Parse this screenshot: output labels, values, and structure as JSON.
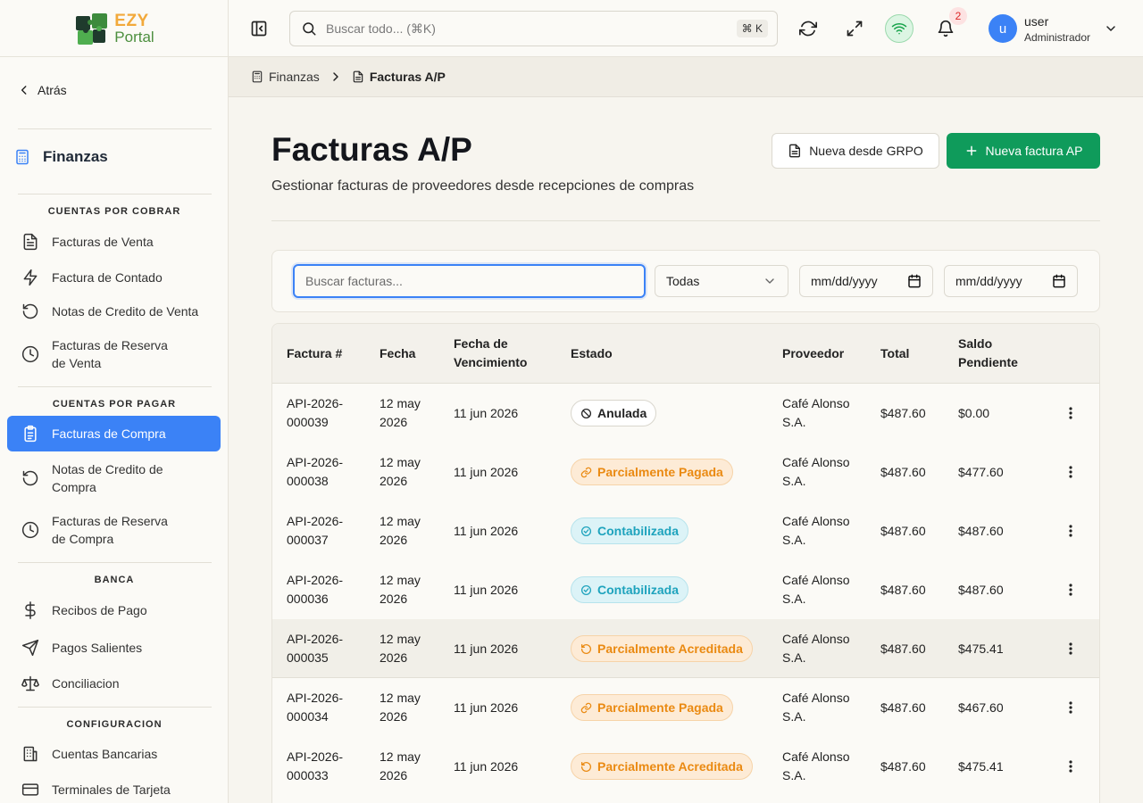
{
  "brand": {
    "logo_top": "EZY",
    "logo_bottom": "Portal"
  },
  "sidebar": {
    "back_label": "Atrás",
    "section_title": "Finanzas",
    "groups": [
      {
        "title": "CUENTAS POR COBRAR",
        "items": [
          {
            "label": "Facturas de Venta",
            "icon": "document-icon"
          },
          {
            "label": "Factura de Contado",
            "icon": "bolt-icon"
          },
          {
            "label": "Notas de Credito de Venta",
            "icon": "rotate-ccw-icon"
          },
          {
            "label": "Facturas de Reserva de Venta",
            "icon": "clock-icon"
          }
        ]
      },
      {
        "title": "CUENTAS POR PAGAR",
        "items": [
          {
            "label": "Facturas de Compra",
            "icon": "clipboard-list-icon",
            "active": true
          },
          {
            "label": "Notas de Credito de Compra",
            "icon": "rotate-ccw-icon"
          },
          {
            "label": "Facturas de Reserva de Compra",
            "icon": "clock-icon"
          }
        ]
      },
      {
        "title": "BANCA",
        "items": [
          {
            "label": "Recibos de Pago",
            "icon": "dollar-icon"
          },
          {
            "label": "Pagos Salientes",
            "icon": "send-icon"
          },
          {
            "label": "Conciliacion",
            "icon": "scale-icon"
          }
        ]
      },
      {
        "title": "CONFIGURACION",
        "items": [
          {
            "label": "Cuentas Bancarias",
            "icon": "bank-icon"
          },
          {
            "label": "Terminales de Tarjeta",
            "icon": "credit-card-icon"
          }
        ]
      }
    ]
  },
  "topbar": {
    "search_placeholder": "Buscar todo... (⌘K)",
    "shortcut": "⌘ K",
    "notifications_count": "2",
    "avatar_initial": "u",
    "user_name": "user",
    "user_role": "Administrador"
  },
  "breadcrumb": {
    "parent": "Finanzas",
    "current": "Facturas A/P"
  },
  "page": {
    "title": "Facturas A/P",
    "subtitle": "Gestionar facturas de proveedores desde recepciones de compras",
    "btn_grpo": "Nueva desde GRPO",
    "btn_new": "Nueva factura AP"
  },
  "filters": {
    "search_placeholder": "Buscar facturas...",
    "status_selected": "Todas",
    "date_from": "mm/dd/yyyy",
    "date_to": "mm/dd/yyyy"
  },
  "table": {
    "columns": [
      "Factura #",
      "Fecha",
      "Fecha de Vencimiento",
      "Estado",
      "Proveedor",
      "Total",
      "Saldo Pendiente"
    ],
    "rows": [
      {
        "invoice": "API-2026-000039",
        "date": "12 may 2026",
        "due": "11 jun 2026",
        "status": "Anulada",
        "status_type": "anulada",
        "vendor": "Café Alonso S.A.",
        "total": "$487.60",
        "balance": "$0.00"
      },
      {
        "invoice": "API-2026-000038",
        "date": "12 may 2026",
        "due": "11 jun 2026",
        "status": "Parcialmente Pagada",
        "status_type": "pagada",
        "vendor": "Café Alonso S.A.",
        "total": "$487.60",
        "balance": "$477.60"
      },
      {
        "invoice": "API-2026-000037",
        "date": "12 may 2026",
        "due": "11 jun 2026",
        "status": "Contabilizada",
        "status_type": "contab",
        "vendor": "Café Alonso S.A.",
        "total": "$487.60",
        "balance": "$487.60"
      },
      {
        "invoice": "API-2026-000036",
        "date": "12 may 2026",
        "due": "11 jun 2026",
        "status": "Contabilizada",
        "status_type": "contab",
        "vendor": "Café Alonso S.A.",
        "total": "$487.60",
        "balance": "$487.60"
      },
      {
        "invoice": "API-2026-000035",
        "date": "12 may 2026",
        "due": "11 jun 2026",
        "status": "Parcialmente Acreditada",
        "status_type": "acreditada",
        "vendor": "Café Alonso S.A.",
        "total": "$487.60",
        "balance": "$475.41",
        "hover": true
      },
      {
        "invoice": "API-2026-000034",
        "date": "12 may 2026",
        "due": "11 jun 2026",
        "status": "Parcialmente Pagada",
        "status_type": "pagada",
        "vendor": "Café Alonso S.A.",
        "total": "$487.60",
        "balance": "$467.60"
      },
      {
        "invoice": "API-2026-000033",
        "date": "12 may 2026",
        "due": "11 jun 2026",
        "status": "Parcialmente Acreditada",
        "status_type": "acreditada",
        "vendor": "Café Alonso S.A.",
        "total": "$487.60",
        "balance": "$475.41"
      }
    ]
  },
  "colors": {
    "primary": "#0f9b5b",
    "accent": "#3b82f6",
    "warning": "#ea8a12",
    "info": "#1ea3bd"
  }
}
